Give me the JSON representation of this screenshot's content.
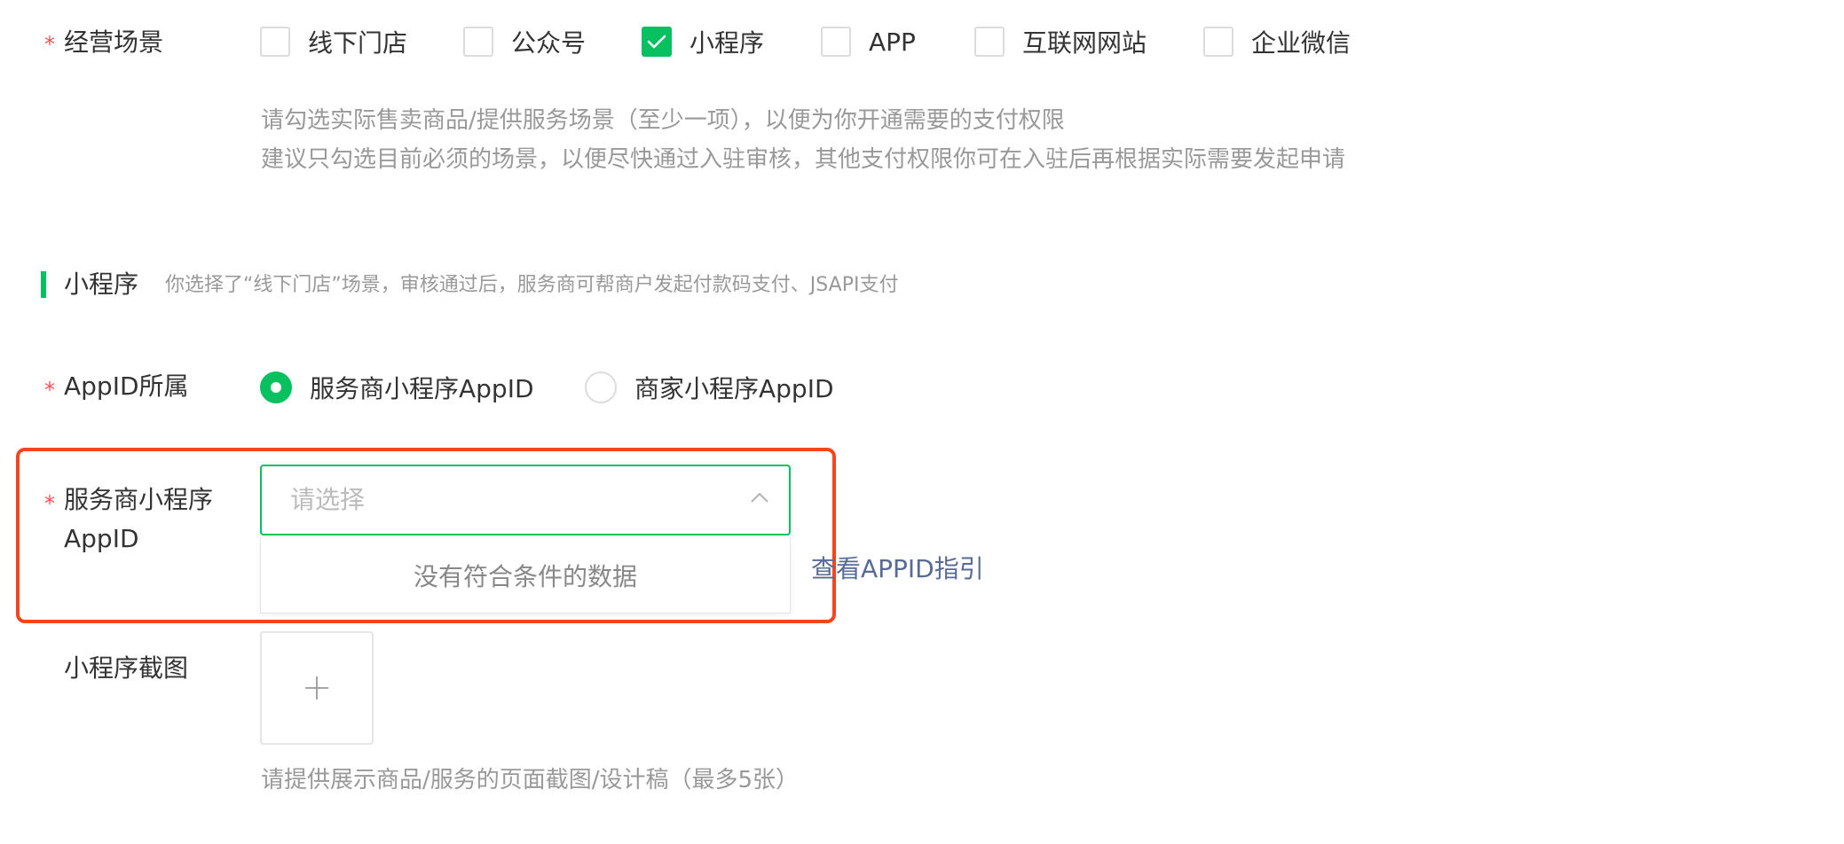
{
  "business_scene": {
    "required_mark": "*",
    "label": "经营场景",
    "options": [
      {
        "label": "线下门店",
        "checked": false
      },
      {
        "label": "公众号",
        "checked": false
      },
      {
        "label": "小程序",
        "checked": true
      },
      {
        "label": "APP",
        "checked": false
      },
      {
        "label": "互联网网站",
        "checked": false
      },
      {
        "label": "企业微信",
        "checked": false
      }
    ],
    "hint_line1": "请勾选实际售卖商品/提供服务场景（至少一项），以便为你开通需要的支付权限",
    "hint_line2": "建议只勾选目前必须的场景，以便尽快通过入驻审核，其他支付权限你可在入驻后再根据实际需要发起申请"
  },
  "section": {
    "title": "小程序",
    "description": "你选择了“线下门店”场景，审核通过后，服务商可帮商户发起付款码支付、JSAPI支付"
  },
  "appid_owner": {
    "required_mark": "*",
    "label": "AppID所属",
    "options": [
      {
        "label": "服务商小程序AppID",
        "selected": true
      },
      {
        "label": "商家小程序AppID",
        "selected": false
      }
    ]
  },
  "sp_appid": {
    "required_mark": "*",
    "label_line1": "服务商小程序",
    "label_line2": "AppID",
    "placeholder": "请选择",
    "empty_text": "没有符合条件的数据",
    "guide_link": "查看APPID指引"
  },
  "screenshot": {
    "label": "小程序截图",
    "upload_symbol": "+",
    "hint": "请提供展示商品/服务的页面截图/设计稿（最多5张）"
  },
  "colors": {
    "accent": "#07c160",
    "required": "#fa5151",
    "link": "#576b95",
    "highlight": "#f5441e",
    "hint_text": "#999999"
  },
  "icons": {
    "check": "check-icon",
    "chevron": "chevron-up-icon",
    "plus": "plus-icon"
  }
}
